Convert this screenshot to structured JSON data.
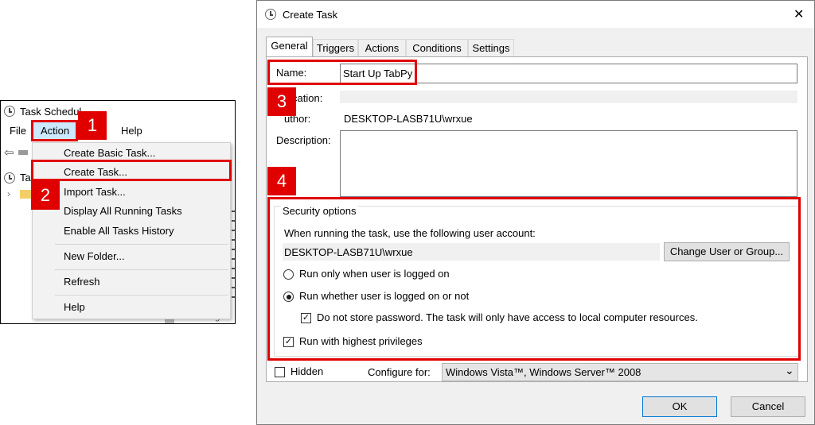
{
  "left_window": {
    "title": "Task Schedul",
    "menu": [
      "File",
      "Action",
      "Help"
    ],
    "tree_fragment": "Tas",
    "bg_fragment": "ItneibLog",
    "dropdown_items": [
      "Create Basic Task...",
      "Create Task...",
      "Import Task...",
      "Display All Running Tasks",
      "Enable All Tasks History",
      "New Folder...",
      "Refresh",
      "Help"
    ]
  },
  "callouts": [
    "1",
    "2",
    "3",
    "4"
  ],
  "dialog": {
    "title": "Create Task",
    "close_glyph": "✕",
    "tabs": [
      "General",
      "Triggers",
      "Actions",
      "Conditions",
      "Settings"
    ],
    "name_label": "Name:",
    "name_value": "Start Up TabPy",
    "location_label": "cation:",
    "location_value": "\\",
    "author_label": "uthor:",
    "author_value": "DESKTOP-LASB71U\\wrxue",
    "description_label": "Description:",
    "security_title": "Security options",
    "account_prompt": "When running the task, use the following user account:",
    "account_value": "DESKTOP-LASB71U\\wrxue",
    "change_user_button": "Change User or Group...",
    "radio_logged_on": "Run only when user is logged on",
    "radio_whether": "Run whether user is logged on or not",
    "do_not_store": "Do not store password.  The task will only have access to local computer resources.",
    "highest_priv": "Run with highest privileges",
    "hidden_label": "Hidden",
    "configure_label": "Configure for:",
    "configure_value": "Windows Vista™, Windows Server™ 2008",
    "ok_button": "OK",
    "cancel_button": "Cancel",
    "check_glyph": "✓",
    "dropdown_glyph": "⌄"
  },
  "colors": {
    "highlight": "#e00000",
    "menu_highlight": "#cce8ff"
  }
}
